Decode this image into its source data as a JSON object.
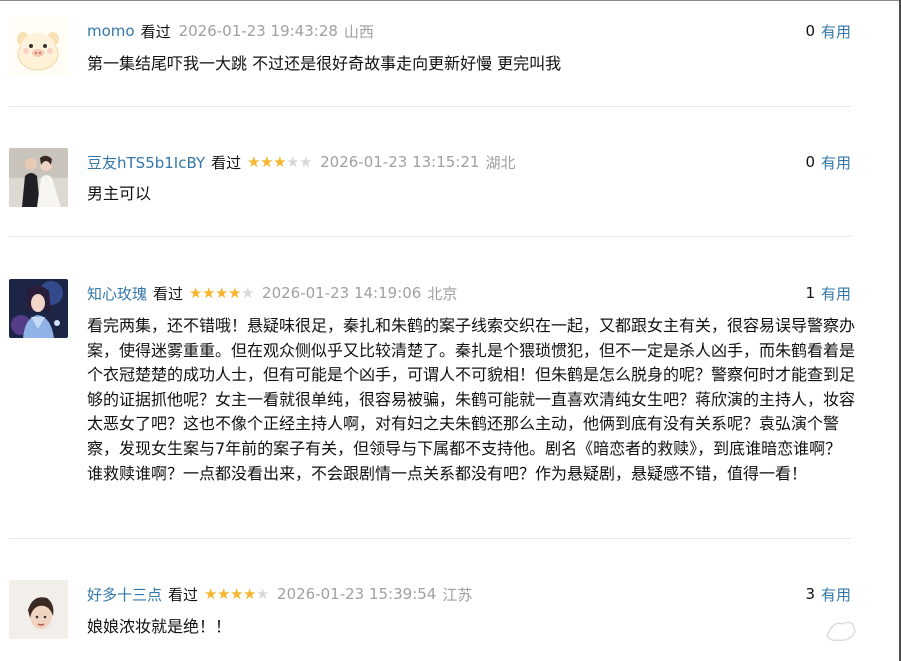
{
  "comments": [
    {
      "user": "momo",
      "action": "看过",
      "rating": 0,
      "time": "2026-01-23 19:43:28",
      "location": "山西",
      "useful_count": "0",
      "useful_label": "有用",
      "text": "第一集结尾吓我一大跳 不过还是很好奇故事走向更新好慢 更完叫我",
      "avatar": "cartoon-pig-avatar"
    },
    {
      "user": "豆友hTS5b1IcBY",
      "action": "看过",
      "rating": 3,
      "time": "2026-01-23 13:15:21",
      "location": "湖北",
      "useful_count": "0",
      "useful_label": "有用",
      "text": "男主可以",
      "avatar": "wedding-photo-avatar"
    },
    {
      "user": "知心玫瑰",
      "action": "看过",
      "rating": 4,
      "time": "2026-01-23 14:19:06",
      "location": "北京",
      "useful_count": "1",
      "useful_label": "有用",
      "text": "看完两集，还不错哦！悬疑味很足，秦扎和朱鹤的案子线索交织在一起，又都跟女主有关，很容易误导警察办案，使得迷雾重重。但在观众侧似乎又比较清楚了。秦扎是个猥琐惯犯，但不一定是杀人凶手，而朱鹤看着是个衣冠楚楚的成功人士，但有可能是个凶手，可谓人不可貌相！但朱鹤是怎么脱身的呢？警察何时才能查到足够的证据抓他呢？女主一看就很单纯，很容易被骗，朱鹤可能就一直喜欢清纯女生吧？蒋欣演的主持人，妆容太恶女了吧？这也不像个正经主持人啊，对有妇之夫朱鹤还那么主动，他俩到底有没有关系呢？袁弘演个警察，发现女生案与7年前的案子有关，但领导与下属都不支持他。剧名《暗恋者的救赎》，到底谁暗恋谁啊？谁救赎谁啊？一点都没看出来，不会跟剧情一点关系都没有吧？作为悬疑剧，悬疑感不错，值得一看！",
      "avatar": "fantasy-character-avatar"
    },
    {
      "user": "好多十三点",
      "action": "看过",
      "rating": 4,
      "time": "2026-01-23 15:39:54",
      "location": "江苏",
      "useful_count": "3",
      "useful_label": "有用",
      "text": "娘娘浓妆就是绝！！",
      "avatar": "portrait-avatar"
    }
  ],
  "colors": {
    "username": "#3377aa",
    "star_on": "#f7b52c",
    "star_off": "#d8d8d8",
    "meta_gray": "#a0a0a0"
  }
}
